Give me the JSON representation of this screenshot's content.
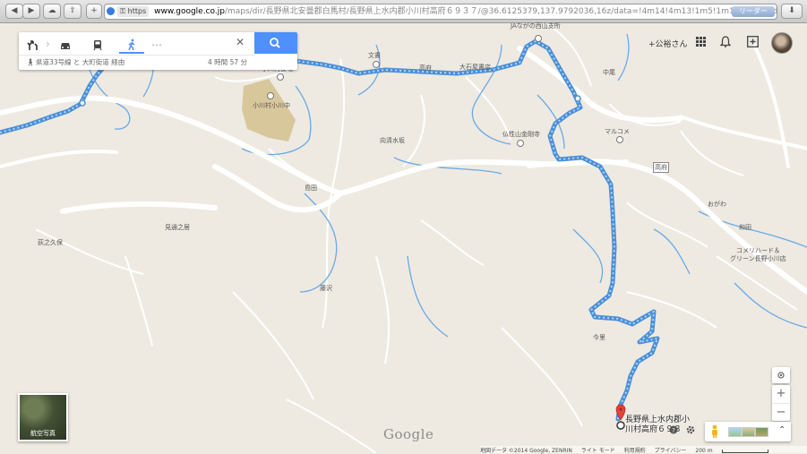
{
  "browser": {
    "https_badge": "https",
    "url_host": "www.google.co.jp",
    "url_path": "/maps/dir/長野県北安曇郡白馬村/長野県上水内郡小川村高府６９３７/@36.6125379,137.9792036,16z/data=!4m14!4m13!1m5!1m1!1s0x5ff7d1e34aa1fee7:",
    "reader_label": "リーダー"
  },
  "directions": {
    "route_summary": "県道33号線 と 大町街道 経由",
    "duration": "4 時間 57 分",
    "more_label": "…",
    "close_label": "✕"
  },
  "header": {
    "user_name": "+公裕さん"
  },
  "places": [
    {
      "text": "JAながの西山支所"
    },
    {
      "text": "文書"
    },
    {
      "text": "小川村役場"
    },
    {
      "text": "高府"
    },
    {
      "text": "大石屋書店"
    },
    {
      "text": "小川村小川中"
    },
    {
      "text": "向清水坂"
    },
    {
      "text": "仏性山金剛寺"
    },
    {
      "text": "マルコメ"
    },
    {
      "text": "中尾"
    },
    {
      "text": "高府"
    },
    {
      "text": "おがわ"
    },
    {
      "text": "島田"
    },
    {
      "text": "見通之居"
    },
    {
      "text": "荻之久保"
    },
    {
      "text": "和田"
    },
    {
      "text": "コメリハード＆"
    },
    {
      "text": "グリーン長野小川店"
    },
    {
      "text": "藤沢"
    },
    {
      "text": "今里"
    }
  ],
  "destination": {
    "line1": "長野県上水内郡小",
    "line2": "川村高府６９３"
  },
  "satellite": {
    "label": "航空写真"
  },
  "zoom": {
    "in": "+",
    "out": "−"
  },
  "footer": {
    "attribution": "地図データ ©2014 Google, ZENRIN",
    "lite_mode": "ライト モード",
    "terms": "利用規約",
    "privacy": "プライバシー",
    "scale": "200 m"
  },
  "logo": "Google",
  "colors": {
    "route": "#4a8fd8",
    "route_dots": "#b8d4f3",
    "water": "#6aa9e6",
    "road": "#ffffff",
    "land": "#eeeae2",
    "park": "#d9c79c",
    "search_button": "#4d90fe",
    "marker": "#e2443a"
  },
  "icons": [
    "back-icon",
    "forward-icon",
    "cloud-icon",
    "share-icon",
    "add-tab-icon",
    "globe-icon",
    "lock-icon",
    "reload-icon",
    "download-icon",
    "directions-icon",
    "car-icon",
    "transit-icon",
    "walk-icon",
    "search-icon",
    "apps-icon",
    "bell-icon",
    "plus-icon",
    "pegman-icon",
    "rotate-icon",
    "compass-icon",
    "expand-icon",
    "marker-icon"
  ]
}
